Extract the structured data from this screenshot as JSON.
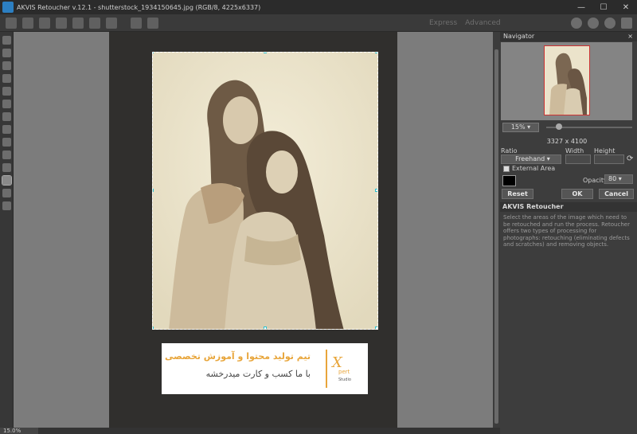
{
  "titlebar": {
    "title": "AKVIS Retoucher v.12.1 - shutterstock_1934150645.jpg (RGB/8, 4225x6337)",
    "buttons": [
      "minimize-icon",
      "maximize-icon",
      "close-icon"
    ]
  },
  "toolbar": {
    "modes": [
      "Express",
      "Advanced"
    ],
    "icons": [
      "open-icon",
      "save-icon",
      "print-icon",
      "batch-icon",
      "share-icon",
      "run-icon",
      "run-alt-icon",
      "undo-icon",
      "redo-icon",
      "info-icon",
      "help-icon",
      "settings-icon",
      "bookmark-icon"
    ]
  },
  "tools": [
    "brush-tool",
    "patch-tool",
    "eraser-tool",
    "clone-tool",
    "chisel-tool",
    "pencil-tool",
    "select-tool",
    "fill-tool",
    "eyedropper-tool",
    "stamp-tool",
    "crop-tool",
    "hand-tool",
    "zoom-tool"
  ],
  "canvas": {
    "zoom_label": "15.0%"
  },
  "watermark": {
    "line1": "تیم تولید محتوا و آموزش تخصصی",
    "line2": "با ما کسب و کارت میدرخشه",
    "logo_text": "Xpert Studio"
  },
  "navigator": {
    "header": "Navigator",
    "close": "×",
    "zoom": "15%",
    "zoom_level": 0.15,
    "dimensions": "3327 x 4100"
  },
  "crop": {
    "ratio_label": "Ratio",
    "width_label": "Width",
    "height_label": "Height",
    "ratio_value": "Freehand",
    "width_value": "",
    "height_value": "",
    "external_area_label": "External Area",
    "opacity_label": "Opacity",
    "opacity_value": "80",
    "reset": "Reset",
    "ok": "OK",
    "cancel": "Cancel"
  },
  "info": {
    "title": "AKVIS Retoucher",
    "text": "Select the areas of the image which need to be retouched and run the process. Retoucher offers two types of processing for photographs: retouching (eliminating defects and scratches) and removing objects."
  },
  "colors": {
    "accent": "#2bc0d0",
    "watermark_orange": "#e8a53a",
    "panel_bg": "#3d3d3d"
  }
}
